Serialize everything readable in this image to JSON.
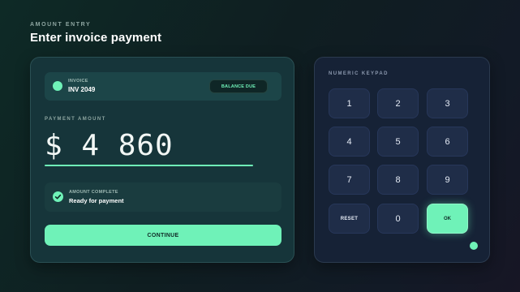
{
  "header": {
    "eyebrow": "AMOUNT ENTRY",
    "title": "Enter invoice payment"
  },
  "invoice": {
    "label": "INVOICE",
    "number": "INV 2049",
    "badge": "BALANCE DUE"
  },
  "amount": {
    "label": "PAYMENT AMOUNT",
    "value": "$ 4 860"
  },
  "status": {
    "label": "AMOUNT COMPLETE",
    "text": "Ready for payment"
  },
  "actions": {
    "continue_label": "CONTINUE"
  },
  "keypad": {
    "title": "NUMERIC KEYPAD",
    "keys": [
      "1",
      "2",
      "3",
      "4",
      "5",
      "6",
      "7",
      "8",
      "9",
      "RESET",
      "0",
      "OK"
    ]
  },
  "colors": {
    "accent": "#6ff2b8",
    "entry_card": "#16353a",
    "keypad_card": "#162236"
  },
  "icons": {
    "invoice": "status-dot-icon",
    "status": "check-circle-icon"
  }
}
